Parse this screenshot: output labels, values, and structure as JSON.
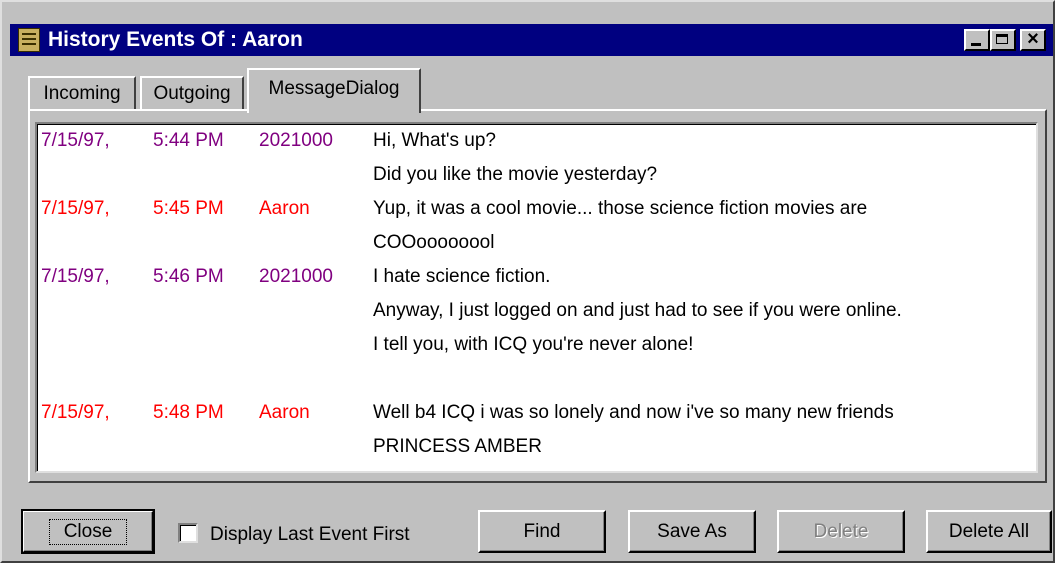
{
  "window": {
    "title": "History Events Of : Aaron",
    "controls": {
      "close_glyph": "×"
    }
  },
  "tabs": [
    {
      "label": "Incoming",
      "active": false
    },
    {
      "label": "Outgoing",
      "active": false
    },
    {
      "label": "MessageDialog",
      "active": true
    }
  ],
  "colors": {
    "sent": "#800080",
    "received": "#ff0000",
    "titlebar": "#000080",
    "face": "#c0c0c0"
  },
  "events": [
    {
      "date": "7/15/97,",
      "time": "5:44 PM",
      "user": "2021000",
      "kind": "sent",
      "lines": [
        "Hi, What's up?",
        "Did you like the movie yesterday?"
      ]
    },
    {
      "date": "7/15/97,",
      "time": "5:45 PM",
      "user": "Aaron",
      "kind": "received",
      "lines": [
        "Yup, it was a cool movie... those science fiction movies are",
        "COOoooooool"
      ]
    },
    {
      "date": "7/15/97,",
      "time": "5:46 PM",
      "user": "2021000",
      "kind": "sent",
      "lines": [
        "I hate science fiction.",
        "Anyway, I just logged on and just had to see if you were online.",
        "I tell you, with ICQ you're never alone!"
      ]
    },
    {
      "date": "7/15/97,",
      "time": "5:48 PM",
      "user": "Aaron",
      "kind": "received",
      "lines": [
        "Well b4 ICQ i was so lonely and now i've so many new friends",
        "PRINCESS AMBER"
      ]
    }
  ],
  "buttons": {
    "close": "Close",
    "find": "Find",
    "save_as": "Save As",
    "delete": "Delete",
    "delete_all": "Delete All"
  },
  "options": {
    "display_last_first": {
      "label": "Display Last Event First",
      "checked": false
    }
  }
}
